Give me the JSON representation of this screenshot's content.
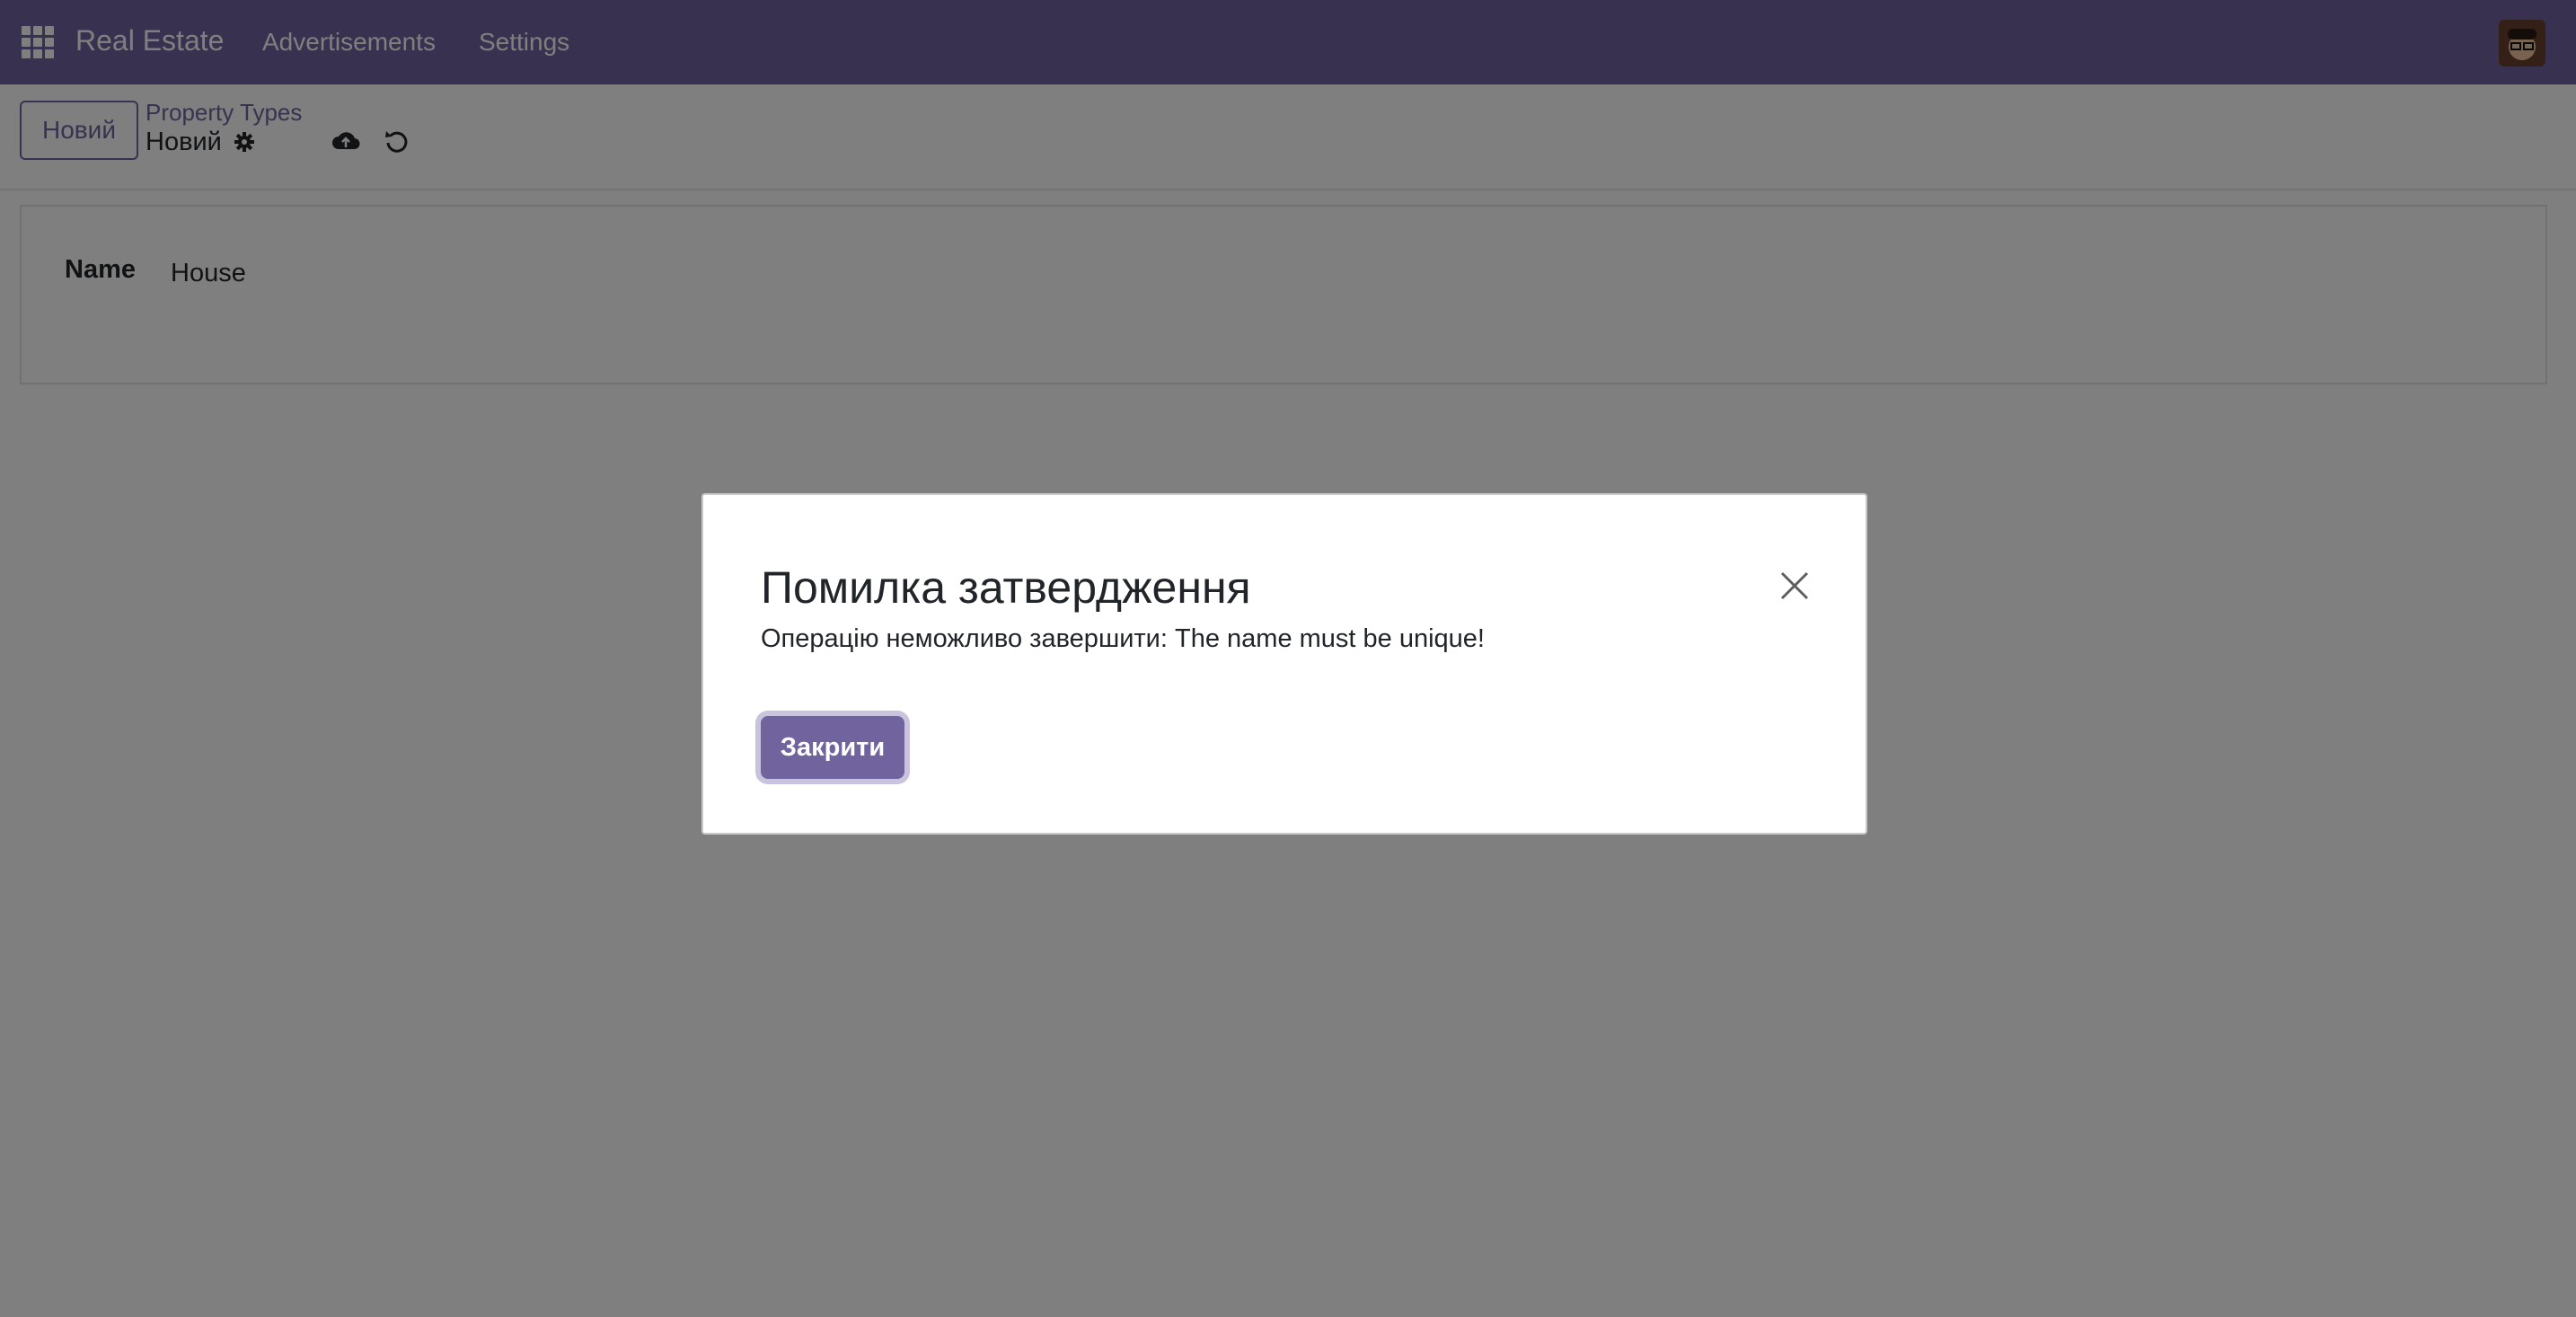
{
  "navbar": {
    "brand": "Real Estate",
    "menu": [
      "Advertisements",
      "Settings"
    ],
    "apps_icon": "grid-icon",
    "avatar_icon": "user-avatar"
  },
  "control_panel": {
    "new_button": "Новий",
    "breadcrumb": "Property Types",
    "record_title": "Новий",
    "icons": [
      "gear-icon",
      "cloud-upload-icon",
      "undo-icon"
    ]
  },
  "form": {
    "name_label": "Name",
    "name_value": "House"
  },
  "dialog": {
    "title": "Помилка затвердження",
    "message": "Операцію неможливо завершити: The name must be unique!",
    "close_button": "Закрити"
  },
  "colors": {
    "brand": "#71639e",
    "backdrop": "rgba(0,0,0,0.5)"
  }
}
